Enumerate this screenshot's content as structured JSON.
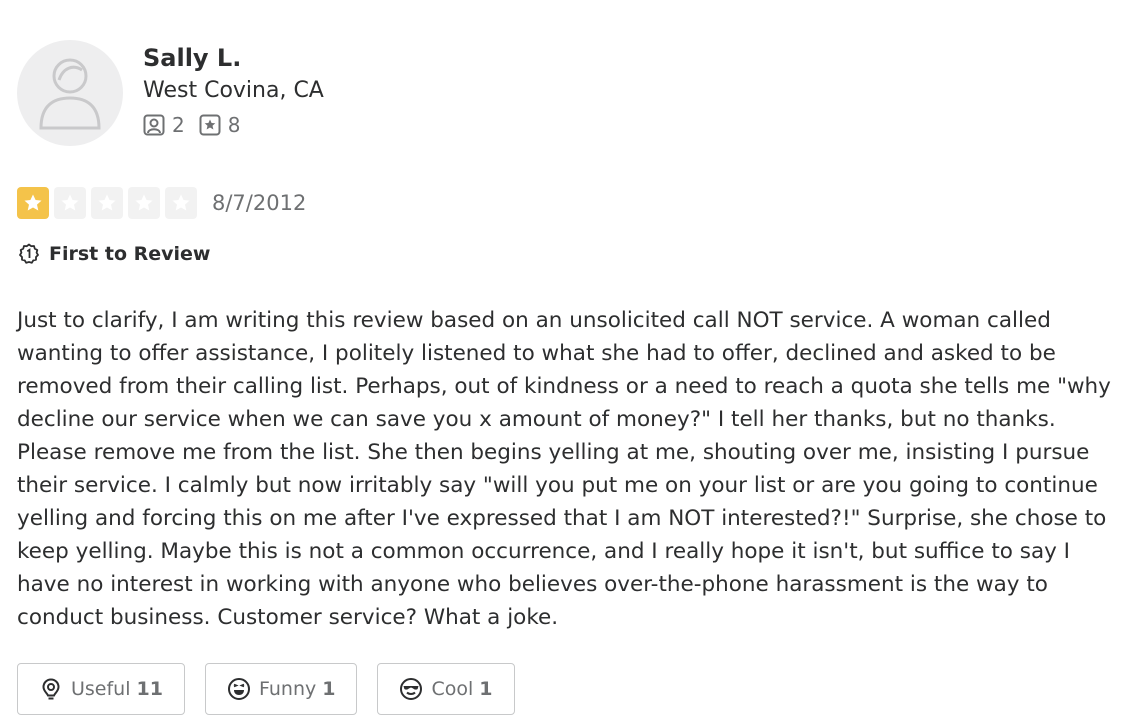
{
  "user": {
    "name": "Sally L.",
    "location": "West Covina, CA",
    "friends_count": "2",
    "reviews_count": "8",
    "avatar_icon": "default-avatar-icon",
    "friends_icon": "friends-icon",
    "reviews_icon": "reviews-star-icon"
  },
  "review": {
    "rating": 1,
    "max_rating": 5,
    "date": "8/7/2012",
    "badge": "First to Review",
    "badge_icon": "first-review-icon",
    "text": "Just to clarify, I am writing this review based on an unsolicited call NOT service. A woman called wanting to offer assistance, I politely listened to what she had to offer, declined and asked to be removed from their calling list. Perhaps, out of kindness or a need to reach a quota she tells me \"why decline our service when we can save you x amount of money?\" I tell her thanks, but no thanks. Please remove me from the list. She then begins yelling at me, shouting over me, insisting I pursue their service. I calmly but now irritably say \"will you put me on your list or are you going to continue yelling and forcing this on me after I've expressed that I am NOT interested?!\" Surprise, she chose to keep yelling. Maybe this is not a common occurrence, and I really hope it isn't, but suffice to say I have no interest in working with anyone who believes over-the-phone harassment is the way to conduct business. Customer service? What a joke."
  },
  "reactions": {
    "useful_label": "Useful",
    "useful_count": "11",
    "funny_label": "Funny",
    "funny_count": "1",
    "cool_label": "Cool",
    "cool_count": "1"
  },
  "colors": {
    "star_active": "#f4c34a",
    "star_inactive": "#f2f2f2",
    "text": "#2d2e2f",
    "muted": "#6e7072",
    "border": "#c8c9ca"
  }
}
